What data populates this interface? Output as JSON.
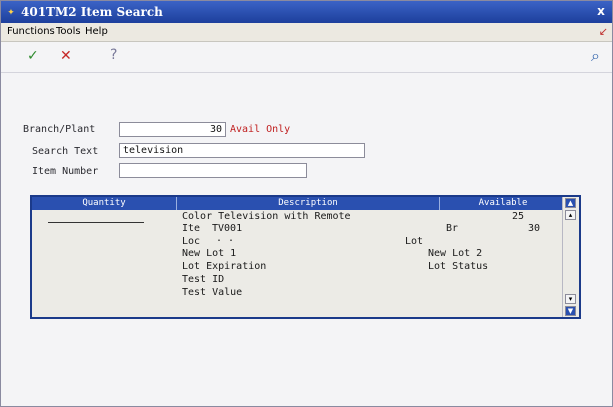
{
  "window": {
    "title": "401TM2  Item Search",
    "close_glyph": "x"
  },
  "menu": {
    "items": [
      "Functions",
      "Tools",
      "Help"
    ]
  },
  "toolbar": {
    "ok_glyph": "✓",
    "cancel_glyph": "✕",
    "help_glyph": "?",
    "search_glyph": "⌕"
  },
  "form": {
    "branch_plant": {
      "label": "Branch/Plant",
      "value": "30"
    },
    "avail_only": "Avail Only",
    "search_text": {
      "label": "Search Text",
      "value": "television"
    },
    "item_number": {
      "label": "Item Number",
      "value": ""
    }
  },
  "grid": {
    "headers": [
      "Quantity",
      "Description",
      "Available"
    ],
    "row": {
      "description": "Color Television with Remote",
      "available": "25",
      "item_label": "Ite",
      "item_value": "TV001",
      "br_label": "Br",
      "br_value": "30",
      "loc_label": "Loc",
      "loc_value": ".   .",
      "lot_label": "Lot",
      "new_lot_1": "New Lot 1",
      "new_lot_2": "New Lot 2",
      "lot_expiration": "Lot Expiration",
      "lot_status": "Lot Status",
      "test_id": "Test ID",
      "test_value": "Test Value"
    }
  },
  "colors": {
    "title_bar": "#1d3f9c",
    "grid_header": "#2a50b0",
    "avail_text": "#c02020"
  }
}
